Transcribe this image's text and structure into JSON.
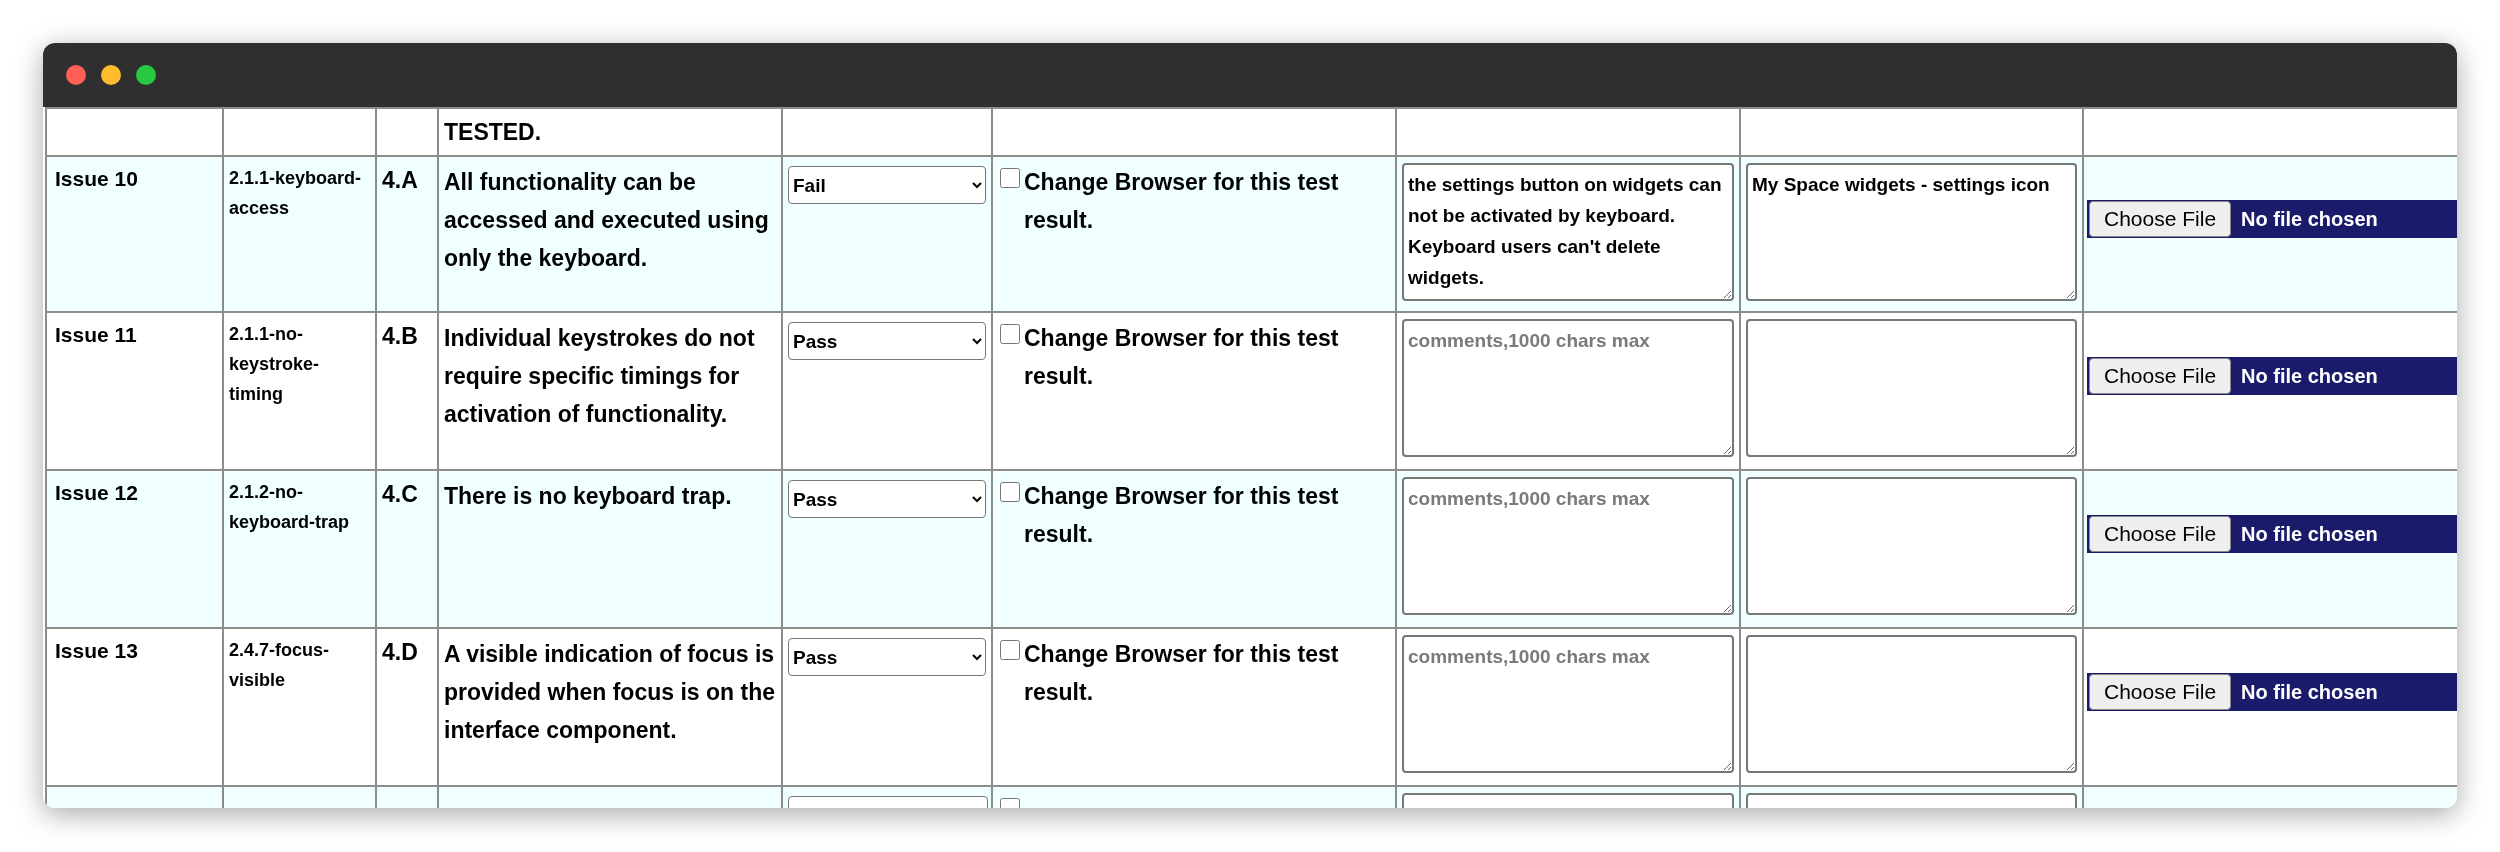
{
  "window": {
    "controls": [
      {
        "color": "#fe5f57"
      },
      {
        "color": "#febc2e"
      },
      {
        "color": "#28c840"
      }
    ]
  },
  "table": {
    "top_row": {
      "description_tail": "TESTED."
    },
    "rows": [
      {
        "kind": "full",
        "issue": "Issue 10",
        "standard": "2.1.1-keyboard-access",
        "code": "4.A",
        "description": "All functionality can be accessed and executed using only the keyboard.",
        "result": "Fail",
        "change_browser": {
          "label": "Change Browser for this test result.",
          "checked": false
        },
        "comments": {
          "value": "the settings button on widgets can not be activated by keyboard. Keyboard users can't delete widgets."
        },
        "location": {
          "value": "My Space widgets - settings icon"
        },
        "upload": {
          "button": "Choose File",
          "status": "No file chosen"
        }
      },
      {
        "kind": "full",
        "issue": "Issue 11",
        "standard": "2.1.1-no-keystroke-timing",
        "code": "4.B",
        "description": "Individual keystrokes do not require specific timings for activation of functionality.",
        "result": "Pass",
        "change_browser": {
          "label": "Change Browser for this test result.",
          "checked": false
        },
        "comments": {
          "placeholder": "comments,1000 chars max"
        },
        "location": {},
        "upload": {
          "button": "Choose File",
          "status": "No file chosen"
        }
      },
      {
        "kind": "full",
        "issue": "Issue 12",
        "standard": "2.1.2-no-keyboard-trap",
        "code": "4.C",
        "description": "There is no keyboard trap.",
        "result": "Pass",
        "change_browser": {
          "label": "Change Browser for this test result.",
          "checked": false
        },
        "comments": {
          "placeholder": "comments,1000 chars max"
        },
        "location": {},
        "upload": {
          "button": "Choose File",
          "status": "No file chosen"
        }
      },
      {
        "kind": "full",
        "issue": "Issue 13",
        "standard": "2.4.7-focus-visible",
        "code": "4.D",
        "description": "A visible indication of focus is provided when focus is on the interface component.",
        "result": "Pass",
        "change_browser": {
          "label": "Change Browser for this test result.",
          "checked": false
        },
        "comments": {
          "placeholder": "comments,1000 chars max"
        },
        "location": {},
        "upload": {
          "button": "Choose File",
          "status": "No file chosen"
        }
      },
      {
        "kind": "cut",
        "change_browser": {
          "checked": false
        }
      }
    ]
  }
}
